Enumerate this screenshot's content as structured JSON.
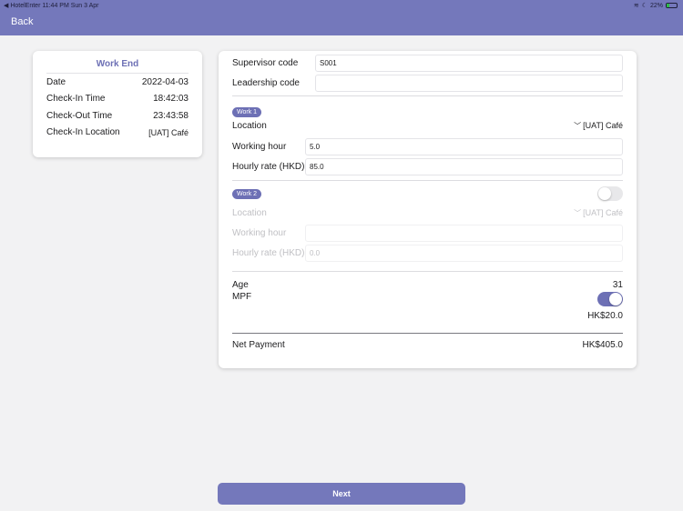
{
  "status_bar": {
    "left": "◀ HotelEnter   11:44 PM   Sun 3 Apr",
    "battery_percent": "22%"
  },
  "nav": {
    "back_label": "Back"
  },
  "summary": {
    "title": "Work End",
    "rows": [
      {
        "label": "Date",
        "value": "2022-04-03"
      },
      {
        "label": "Check-In Time",
        "value": "18:42:03"
      },
      {
        "label": "Check-Out Time",
        "value": "23:43:58"
      },
      {
        "label": "Check-In Location",
        "value": "[UAT] Café"
      }
    ]
  },
  "form": {
    "supervisor_label": "Supervisor code",
    "supervisor_value": "S001",
    "leadership_label": "Leadership code",
    "leadership_value": "",
    "work1": {
      "badge": "Work 1",
      "location_label": "Location",
      "location_value": "[UAT] Café",
      "hour_label": "Working hour",
      "hour_value": "5.0",
      "rate_label": "Hourly rate (HKD)",
      "rate_value": "85.0"
    },
    "work2": {
      "badge": "Work 2",
      "enabled": false,
      "location_label": "Location",
      "location_value": "[UAT] Café",
      "hour_label": "Working hour",
      "hour_value": "",
      "rate_label": "Hourly rate (HKD)",
      "rate_placeholder": "0.0"
    },
    "age_label": "Age",
    "age_value": "31",
    "mpf_label": "MPF",
    "mpf_enabled": true,
    "mpf_amount": "HK$20.0",
    "net_label": "Net Payment",
    "net_value": "HK$405.0"
  },
  "next_label": "Next",
  "colors": {
    "accent": "#7478bb",
    "badge": "#6d70b5"
  }
}
